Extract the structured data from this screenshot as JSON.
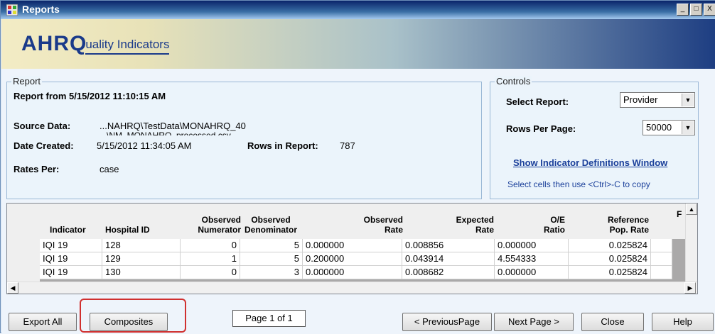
{
  "window": {
    "title": "Reports",
    "min_label": "_",
    "max_label": "□",
    "close_label": "X"
  },
  "banner": {
    "logo_ahrq": "AHRQ",
    "logo_rest": "uality Indicators"
  },
  "report": {
    "legend": "Report",
    "heading": "Report from 5/15/2012 11:10:15 AM",
    "source_label": "Source Data:",
    "source_value_line1": "...NAHRQ\\TestData\\MONAHRQ_40",
    "source_value_line2": "\\NM_MONAHRQ_processed.csv",
    "date_label": "Date Created:",
    "date_value": "5/15/2012 11:34:05 AM",
    "rows_label": "Rows in Report:",
    "rows_value": "787",
    "rates_label": "Rates Per:",
    "rates_value": "case"
  },
  "controls": {
    "legend": "Controls",
    "select_report_label": "Select Report:",
    "select_report_value": "Provider",
    "rows_per_page_label": "Rows Per Page:",
    "rows_per_page_value": "50000",
    "definitions_link": "Show Indicator Definitions Window",
    "copy_hint": "Select cells then use <Ctrl>-C to copy"
  },
  "grid": {
    "columns": [
      {
        "line1": "",
        "line2": "Indicator"
      },
      {
        "line1": "",
        "line2": "Hospital ID"
      },
      {
        "line1": "Observed",
        "line2": "Numerator"
      },
      {
        "line1": "Observed",
        "line2": "Denominator"
      },
      {
        "line1": "Observed",
        "line2": "Rate"
      },
      {
        "line1": "Expected",
        "line2": "Rate"
      },
      {
        "line1": "O/E",
        "line2": "Ratio"
      },
      {
        "line1": "Reference",
        "line2": "Pop. Rate"
      },
      {
        "line1": "F",
        "line2": ""
      }
    ],
    "rows": [
      [
        "IQI 19",
        "128",
        "0",
        "5",
        "0.000000",
        "0.008856",
        "0.000000",
        "0.025824"
      ],
      [
        "IQI 19",
        "129",
        "1",
        "5",
        "0.200000",
        "0.043914",
        "4.554333",
        "0.025824"
      ],
      [
        "IQI 19",
        "130",
        "0",
        "3",
        "0.000000",
        "0.008682",
        "0.000000",
        "0.025824"
      ]
    ]
  },
  "buttons": {
    "export_all": "Export All",
    "composites": "Composites",
    "page_indicator": "Page 1 of 1",
    "previous": "< PreviousPage",
    "next": "Next Page >",
    "close": "Close",
    "help": "Help"
  }
}
